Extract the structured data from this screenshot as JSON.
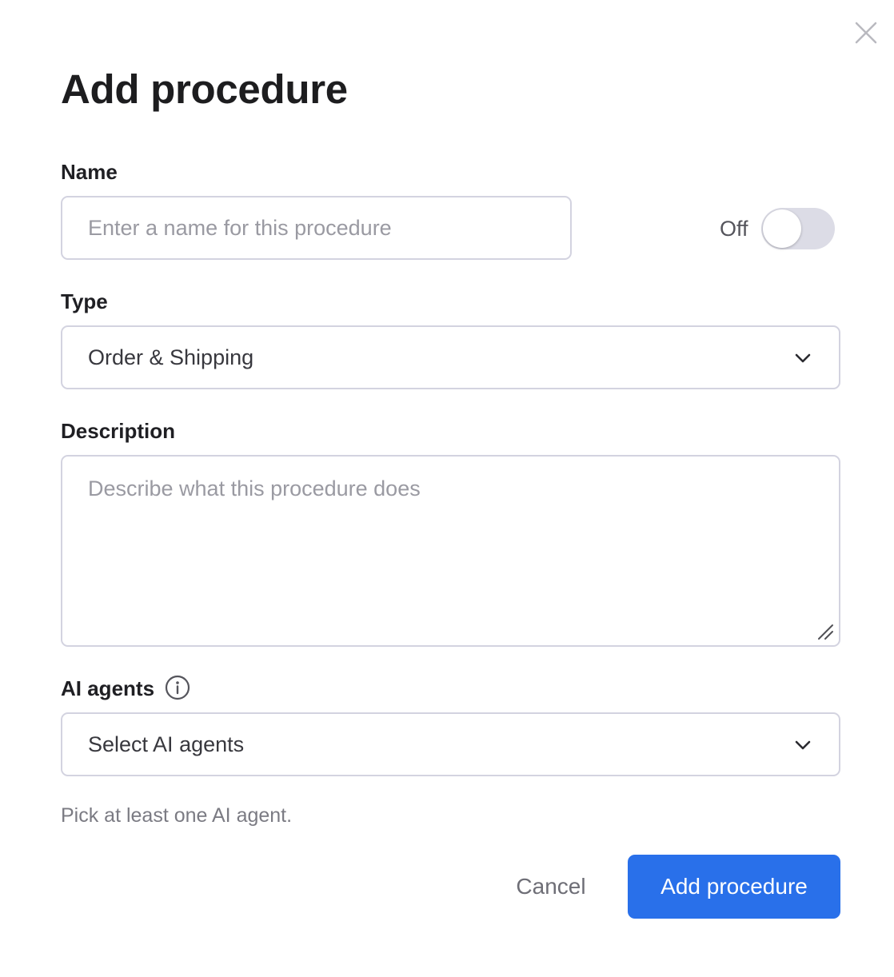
{
  "dialog": {
    "title": "Add procedure",
    "close_icon": "close-icon"
  },
  "name": {
    "label": "Name",
    "value": "",
    "placeholder": "Enter a name for this procedure"
  },
  "status_toggle": {
    "label": "Off",
    "checked": false
  },
  "type": {
    "label": "Type",
    "selected": "Order & Shipping",
    "icon": "chevron-down-icon"
  },
  "description": {
    "label": "Description",
    "value": "",
    "placeholder": "Describe what this procedure does"
  },
  "ai_agents": {
    "label": "AI agents",
    "info_icon": "info-icon",
    "placeholder": "Select AI agents",
    "helper_text": "Pick at least one AI agent.",
    "icon": "chevron-down-icon"
  },
  "actions": {
    "cancel_label": "Cancel",
    "submit_label": "Add procedure"
  },
  "colors": {
    "primary": "#2970ea",
    "border": "#d3d3e0",
    "toggle_off": "#dcdce6"
  }
}
